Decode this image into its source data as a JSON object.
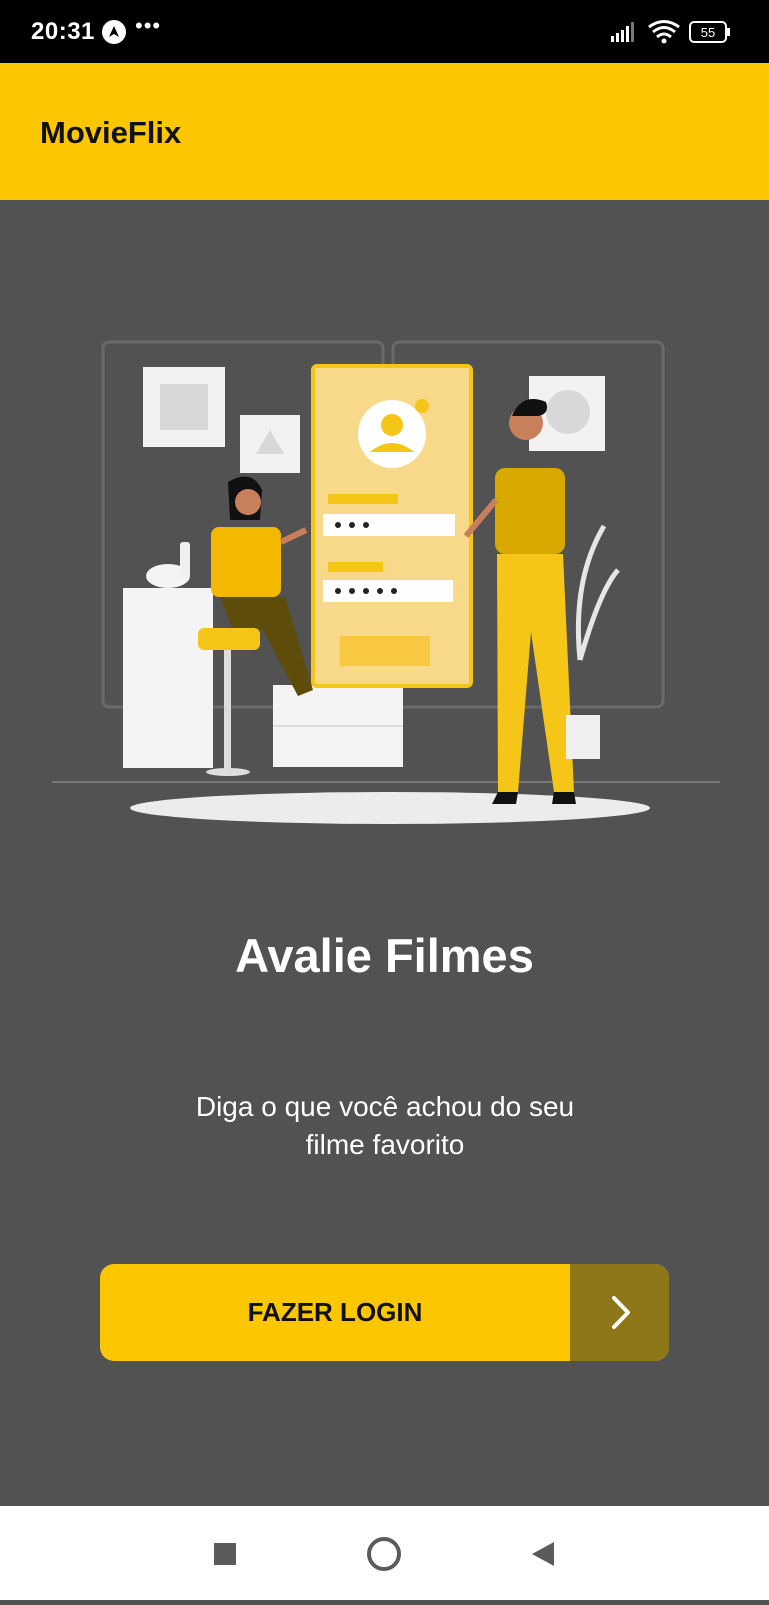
{
  "status_bar": {
    "time": "20:31",
    "battery": "55",
    "icons": [
      "navigation-app-icon",
      "more-dots-icon",
      "signal-icon",
      "wifi-icon",
      "battery-icon"
    ]
  },
  "app_bar": {
    "title": "MovieFlix"
  },
  "main": {
    "headline": "Avalie Filmes",
    "subtitle": "Diga o que você achou do seu filme favorito",
    "login_button": {
      "label": "FAZER LOGIN",
      "icon": "chevron-right-icon"
    }
  },
  "nav_bar": {
    "icons": [
      "recents-square-icon",
      "home-circle-icon",
      "back-triangle-icon"
    ]
  },
  "colors": {
    "accent": "#fcc600",
    "accent_dark": "#8e7718",
    "background": "#525252",
    "status_bar": "#000000",
    "nav_bar": "#ffffff"
  }
}
